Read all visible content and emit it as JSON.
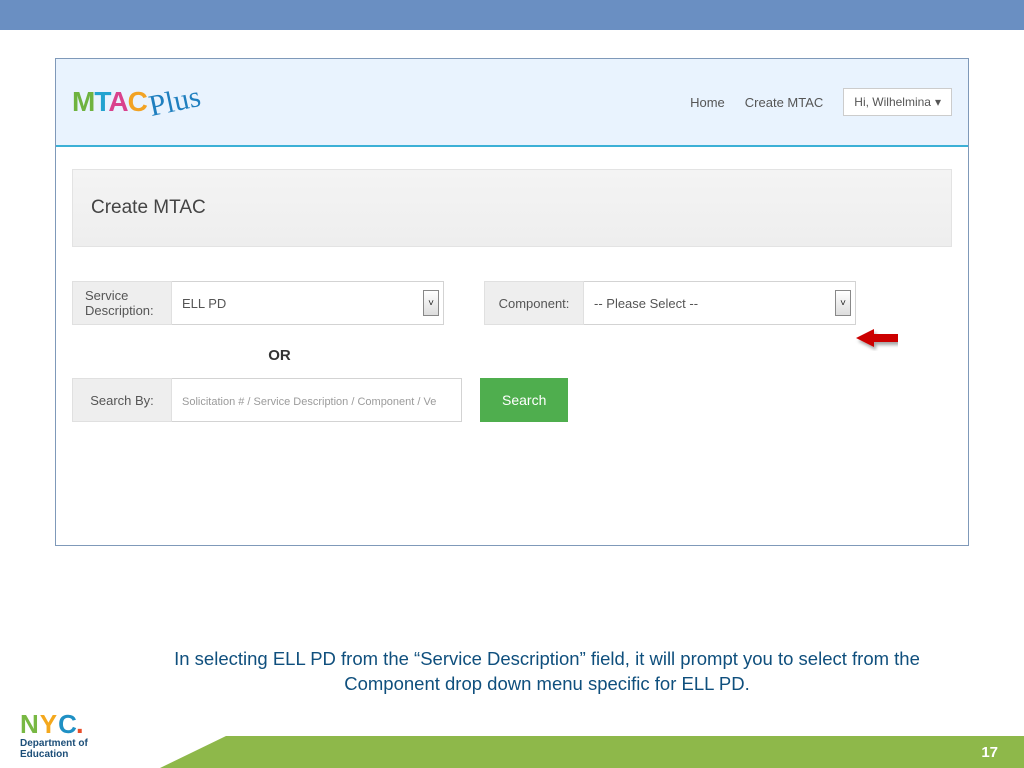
{
  "header": {
    "logo_letters": {
      "m": "M",
      "t": "T",
      "a": "A",
      "c": "C"
    },
    "logo_plus": "Plus",
    "nav_home": "Home",
    "nav_create": "Create MTAC",
    "user_label": "Hi, Wilhelmina",
    "user_caret": "▾"
  },
  "panel": {
    "title": "Create MTAC",
    "service_description_label": "Service Description:",
    "service_description_value": "ELL PD",
    "component_label": "Component:",
    "component_value": "-- Please Select --",
    "or_text": "OR",
    "search_by_label": "Search By:",
    "search_by_placeholder": "Solicitation # / Service Description / Component / Vendor Program Description",
    "search_button": "Search"
  },
  "caption": "In selecting ELL PD from the “Service Description” field, it will prompt you to select from the Component drop down menu specific for ELL PD.",
  "footer": {
    "page_number": "17",
    "doe_line1": "Department of",
    "doe_line2": "Education"
  },
  "colors": {
    "top_bar": "#6a8fc2",
    "accent_green": "#8eb84a",
    "caption_text": "#0f4f7d"
  }
}
